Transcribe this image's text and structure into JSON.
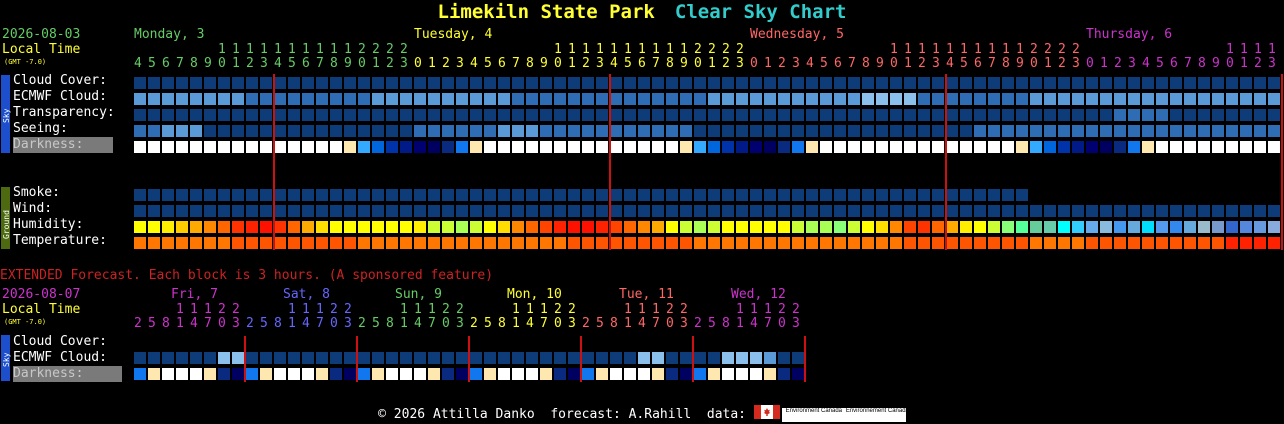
{
  "title": {
    "park": "Limekiln State Park",
    "chart": "Clear Sky Chart"
  },
  "main": {
    "date": "2026-08-03",
    "local_time": "Local Time",
    "gmt": "(GMT -7.0)",
    "days": [
      {
        "label": "Monday, 3",
        "color": "#66cc66"
      },
      {
        "label": "Tuesday, 4",
        "color": "#ffff33"
      },
      {
        "label": "Wednesday, 5",
        "color": "#ff6666"
      },
      {
        "label": "Thursday, 6",
        "color": "#cc33cc"
      }
    ],
    "hours_row1": "1111111222            1111111111112222            1111111111112222            1111111111112222",
    "hours_row2": "456789012301234567890123012345678901230123456789012301234567890123",
    "sky_rows": [
      "Cloud Cover:",
      "ECMWF Cloud:",
      "Transparency:",
      "Seeing:",
      "Darkness:"
    ],
    "ground_rows": [
      "Smoke:",
      "Wind:",
      "Humidity:",
      "Temperature:"
    ],
    "side_sky": "Sky",
    "side_ground": "Ground"
  },
  "extended": {
    "heading": "EXTENDED Forecast. Each block is 3 hours. (A sponsored feature)",
    "date": "2026-08-07",
    "local_time": "Local Time",
    "gmt": "(GMT -7.0)",
    "days": [
      {
        "label": "Fri, 7",
        "color": "#cc33cc"
      },
      {
        "label": "Sat, 8",
        "color": "#6666ff"
      },
      {
        "label": "Sun, 9",
        "color": "#66cc66"
      },
      {
        "label": "Mon, 10",
        "color": "#ffff33"
      },
      {
        "label": "Tue, 11",
        "color": "#ff6666"
      },
      {
        "label": "Wed, 12",
        "color": "#cc33cc"
      }
    ],
    "hours_row1": "11122",
    "hours_row2": "25814703",
    "sky_rows": [
      "Cloud Cover:",
      "ECMWF Cloud:",
      "Darkness:"
    ],
    "side_sky": "Sky"
  },
  "footer": {
    "copyright": "© 2026 Attilla Danko  forecast: A.Rahill  data:",
    "env1": "Environment Canada",
    "env2": "Environnement Canada"
  },
  "colors": {
    "dark_blue": "#0d3c78",
    "mid_blue": "#2e6db4",
    "light_blue": "#5a9ad6",
    "pale_blue": "#8cc0ec",
    "grid_line": "#cc1111"
  }
}
